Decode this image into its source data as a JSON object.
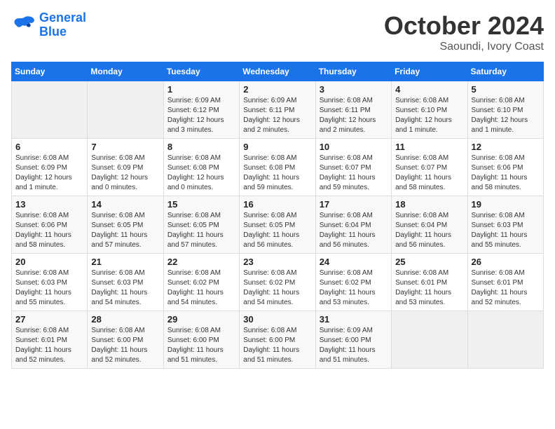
{
  "header": {
    "logo_line1": "General",
    "logo_line2": "Blue",
    "title": "October 2024",
    "subtitle": "Saoundi, Ivory Coast"
  },
  "columns": [
    "Sunday",
    "Monday",
    "Tuesday",
    "Wednesday",
    "Thursday",
    "Friday",
    "Saturday"
  ],
  "weeks": [
    [
      {
        "day": "",
        "info": ""
      },
      {
        "day": "",
        "info": ""
      },
      {
        "day": "1",
        "info": "Sunrise: 6:09 AM\nSunset: 6:12 PM\nDaylight: 12 hours\nand 3 minutes."
      },
      {
        "day": "2",
        "info": "Sunrise: 6:09 AM\nSunset: 6:11 PM\nDaylight: 12 hours\nand 2 minutes."
      },
      {
        "day": "3",
        "info": "Sunrise: 6:08 AM\nSunset: 6:11 PM\nDaylight: 12 hours\nand 2 minutes."
      },
      {
        "day": "4",
        "info": "Sunrise: 6:08 AM\nSunset: 6:10 PM\nDaylight: 12 hours\nand 1 minute."
      },
      {
        "day": "5",
        "info": "Sunrise: 6:08 AM\nSunset: 6:10 PM\nDaylight: 12 hours\nand 1 minute."
      }
    ],
    [
      {
        "day": "6",
        "info": "Sunrise: 6:08 AM\nSunset: 6:09 PM\nDaylight: 12 hours\nand 1 minute."
      },
      {
        "day": "7",
        "info": "Sunrise: 6:08 AM\nSunset: 6:09 PM\nDaylight: 12 hours\nand 0 minutes."
      },
      {
        "day": "8",
        "info": "Sunrise: 6:08 AM\nSunset: 6:08 PM\nDaylight: 12 hours\nand 0 minutes."
      },
      {
        "day": "9",
        "info": "Sunrise: 6:08 AM\nSunset: 6:08 PM\nDaylight: 11 hours\nand 59 minutes."
      },
      {
        "day": "10",
        "info": "Sunrise: 6:08 AM\nSunset: 6:07 PM\nDaylight: 11 hours\nand 59 minutes."
      },
      {
        "day": "11",
        "info": "Sunrise: 6:08 AM\nSunset: 6:07 PM\nDaylight: 11 hours\nand 58 minutes."
      },
      {
        "day": "12",
        "info": "Sunrise: 6:08 AM\nSunset: 6:06 PM\nDaylight: 11 hours\nand 58 minutes."
      }
    ],
    [
      {
        "day": "13",
        "info": "Sunrise: 6:08 AM\nSunset: 6:06 PM\nDaylight: 11 hours\nand 58 minutes."
      },
      {
        "day": "14",
        "info": "Sunrise: 6:08 AM\nSunset: 6:05 PM\nDaylight: 11 hours\nand 57 minutes."
      },
      {
        "day": "15",
        "info": "Sunrise: 6:08 AM\nSunset: 6:05 PM\nDaylight: 11 hours\nand 57 minutes."
      },
      {
        "day": "16",
        "info": "Sunrise: 6:08 AM\nSunset: 6:05 PM\nDaylight: 11 hours\nand 56 minutes."
      },
      {
        "day": "17",
        "info": "Sunrise: 6:08 AM\nSunset: 6:04 PM\nDaylight: 11 hours\nand 56 minutes."
      },
      {
        "day": "18",
        "info": "Sunrise: 6:08 AM\nSunset: 6:04 PM\nDaylight: 11 hours\nand 56 minutes."
      },
      {
        "day": "19",
        "info": "Sunrise: 6:08 AM\nSunset: 6:03 PM\nDaylight: 11 hours\nand 55 minutes."
      }
    ],
    [
      {
        "day": "20",
        "info": "Sunrise: 6:08 AM\nSunset: 6:03 PM\nDaylight: 11 hours\nand 55 minutes."
      },
      {
        "day": "21",
        "info": "Sunrise: 6:08 AM\nSunset: 6:03 PM\nDaylight: 11 hours\nand 54 minutes."
      },
      {
        "day": "22",
        "info": "Sunrise: 6:08 AM\nSunset: 6:02 PM\nDaylight: 11 hours\nand 54 minutes."
      },
      {
        "day": "23",
        "info": "Sunrise: 6:08 AM\nSunset: 6:02 PM\nDaylight: 11 hours\nand 54 minutes."
      },
      {
        "day": "24",
        "info": "Sunrise: 6:08 AM\nSunset: 6:02 PM\nDaylight: 11 hours\nand 53 minutes."
      },
      {
        "day": "25",
        "info": "Sunrise: 6:08 AM\nSunset: 6:01 PM\nDaylight: 11 hours\nand 53 minutes."
      },
      {
        "day": "26",
        "info": "Sunrise: 6:08 AM\nSunset: 6:01 PM\nDaylight: 11 hours\nand 52 minutes."
      }
    ],
    [
      {
        "day": "27",
        "info": "Sunrise: 6:08 AM\nSunset: 6:01 PM\nDaylight: 11 hours\nand 52 minutes."
      },
      {
        "day": "28",
        "info": "Sunrise: 6:08 AM\nSunset: 6:00 PM\nDaylight: 11 hours\nand 52 minutes."
      },
      {
        "day": "29",
        "info": "Sunrise: 6:08 AM\nSunset: 6:00 PM\nDaylight: 11 hours\nand 51 minutes."
      },
      {
        "day": "30",
        "info": "Sunrise: 6:08 AM\nSunset: 6:00 PM\nDaylight: 11 hours\nand 51 minutes."
      },
      {
        "day": "31",
        "info": "Sunrise: 6:09 AM\nSunset: 6:00 PM\nDaylight: 11 hours\nand 51 minutes."
      },
      {
        "day": "",
        "info": ""
      },
      {
        "day": "",
        "info": ""
      }
    ]
  ]
}
